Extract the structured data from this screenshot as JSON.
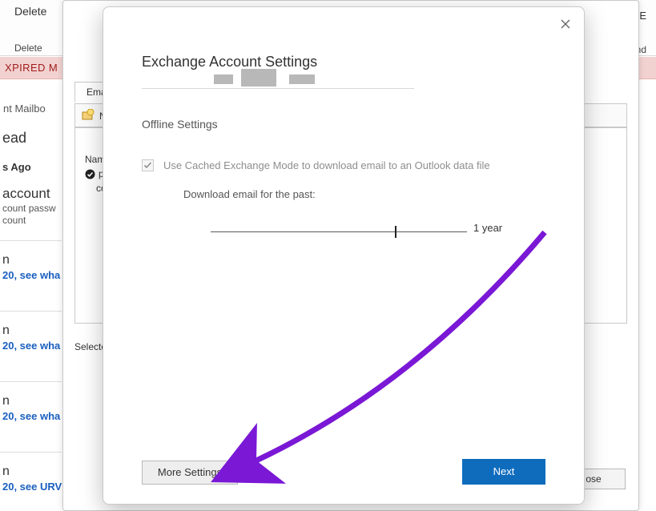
{
  "bg": {
    "delete_big": "Delete",
    "delete_small": "Delete",
    "ema": "Ema",
    "ilter": "ilter E",
    "find": "Find",
    "xpired": "XPIRED   M",
    "mailbox": "nt Mailbo",
    "ead": "ead",
    "s_ago": "s Ago",
    "account": "  account",
    "pass": "count passw",
    "count": "count",
    "item_n": "n",
    "see_wha": "20, see wha",
    "see_urv": "20, see URV"
  },
  "underdialog": {
    "tab_email": "Email",
    "ne": "Ne",
    "name_hdr": "Name",
    "row1": "pa",
    "row2": "co",
    "selected": "Selecte",
    "close": "ose"
  },
  "dialog": {
    "title": "Exchange Account Settings",
    "offline_title": "Offline Settings",
    "cache_label": "Use Cached Exchange Mode to download email to an Outlook data file",
    "download_label": "Download email for the past:",
    "slider_value": "1 year",
    "more_settings": "More Settings",
    "next": "Next"
  }
}
